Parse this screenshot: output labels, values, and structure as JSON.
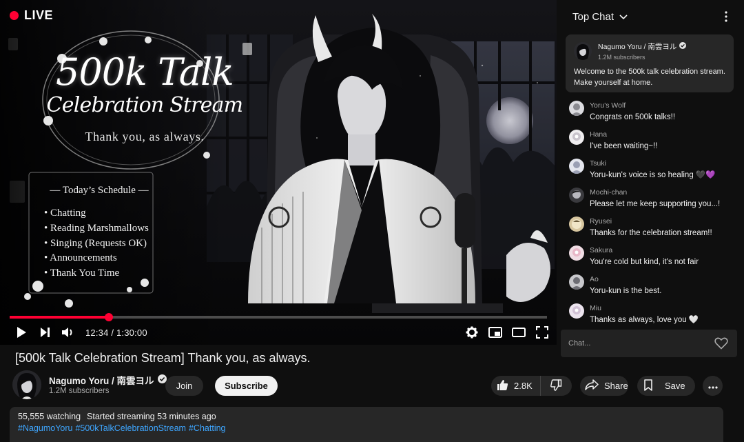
{
  "player": {
    "live_label": "LIVE",
    "overlay": {
      "title_main": "500k Talk",
      "title_sub": "Celebration Stream",
      "thanks": "Thank you, as always."
    },
    "schedule": {
      "title": "— Today’s Schedule —",
      "items": [
        "• Chatting",
        "• Reading Marshmallows",
        "• Singing (Requests OK)",
        "• Announcements",
        "• Thank You Time"
      ]
    },
    "progress": 0.184,
    "time_current": "12:34",
    "time_total": "1:30:00",
    "time_separator": "/",
    "accent": "#ff0033"
  },
  "chat": {
    "header_title": "Top Chat",
    "pinned": {
      "name": "Nagumo Yoru / 南雲ヨル",
      "subs": "1.2M subscribers",
      "message": "Welcome to the 500k talk celebration stream. Make yourself at home."
    },
    "messages": [
      {
        "name": "Yoru's Wolf",
        "text": "Congrats on 500k talks!!"
      },
      {
        "name": "Hana",
        "text": "I've been waiting~!!"
      },
      {
        "name": "Tsuki",
        "text": "Yoru-kun's voice is so healing 🖤💜"
      },
      {
        "name": "Mochi-chan",
        "text": "Please let me keep supporting you...!"
      },
      {
        "name": "Ryusei",
        "text": "Thanks for the celebration stream!!"
      },
      {
        "name": "Sakura",
        "text": "You're cold but kind, it's not fair"
      },
      {
        "name": "Ao",
        "text": "Yoru-kun is the best."
      },
      {
        "name": "Miu",
        "text": "Thanks as always, love you 🤍"
      }
    ],
    "input_placeholder": "Chat..."
  },
  "video": {
    "title": "[500k Talk Celebration Stream] Thank you, as always.",
    "channel_name": "Nagumo Yoru / 南雲ヨル",
    "channel_subs": "1.2M subscribers",
    "join_label": "Join",
    "subscribe_label": "Subscribe",
    "like_count": "2.8K",
    "share_label": "Share",
    "save_label": "Save",
    "watching": "55,555 watching",
    "started": "Started streaming 53 minutes ago",
    "tags": [
      "#NagumoYoru",
      "#500kTalkCelebrationStream",
      "#Chatting"
    ]
  },
  "icons": {
    "play": "play-icon",
    "next": "next-icon",
    "volume": "volume-icon",
    "settings": "gear-icon",
    "miniplayer": "miniplayer-icon",
    "theater": "theater-icon",
    "fullscreen": "fullscreen-icon",
    "verified": "verified-check-icon",
    "like": "thumbs-up-icon",
    "dislike": "thumbs-down-icon",
    "share": "share-arrow-icon",
    "save": "bookmark-icon",
    "more": "more-dots-icon",
    "chat_menu": "vertical-dots-icon",
    "heart": "heart-icon",
    "chevron": "chevron-down-icon"
  },
  "colors": {
    "link": "#3ea6ff",
    "surface": "#272727",
    "background": "#0f0f0f"
  }
}
